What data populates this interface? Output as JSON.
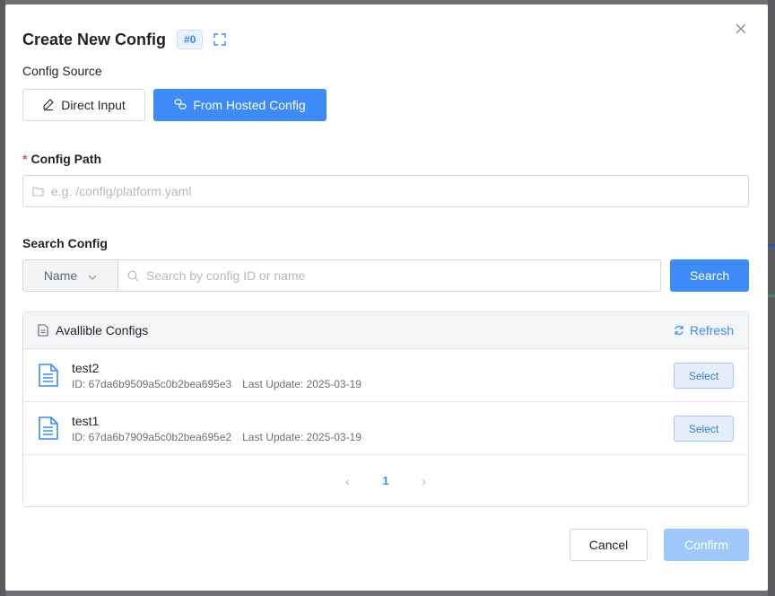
{
  "modal": {
    "title": "Create New Config",
    "id_badge": "#0",
    "icons": {
      "close": "close-icon",
      "expand": "fullscreen-icon"
    }
  },
  "config_source": {
    "label": "Config Source",
    "options": [
      {
        "label": "Direct Input",
        "icon": "pencil-icon",
        "selected": false
      },
      {
        "label": "From Hosted Config",
        "icon": "chain-icon",
        "selected": true
      }
    ]
  },
  "config_path": {
    "required_mark": "*",
    "label": "Config Path",
    "placeholder": "e.g. /config/platform.yaml",
    "value": ""
  },
  "search": {
    "label": "Search Config",
    "field_select": "Name",
    "placeholder": "Search by config ID or name",
    "button": "Search"
  },
  "configs_panel": {
    "title": "Avallible Configs",
    "refresh": "Refresh",
    "items": [
      {
        "name": "test2",
        "id": "ID: 67da6b9509a5c0b2bea695e3",
        "updated": "Last Update: 2025-03-19",
        "action": "Select"
      },
      {
        "name": "test1",
        "id": "ID: 67da6b7909a5c0b2bea695e2",
        "updated": "Last Update: 2025-03-19",
        "action": "Select"
      }
    ],
    "pagination": {
      "current": "1",
      "prev": "‹",
      "next": "›"
    }
  },
  "footer": {
    "cancel": "Cancel",
    "confirm": "Confirm"
  },
  "colors": {
    "primary": "#3d8bf7",
    "primary_disabled": "#9fc9fa",
    "overlay": "#6f7073"
  }
}
